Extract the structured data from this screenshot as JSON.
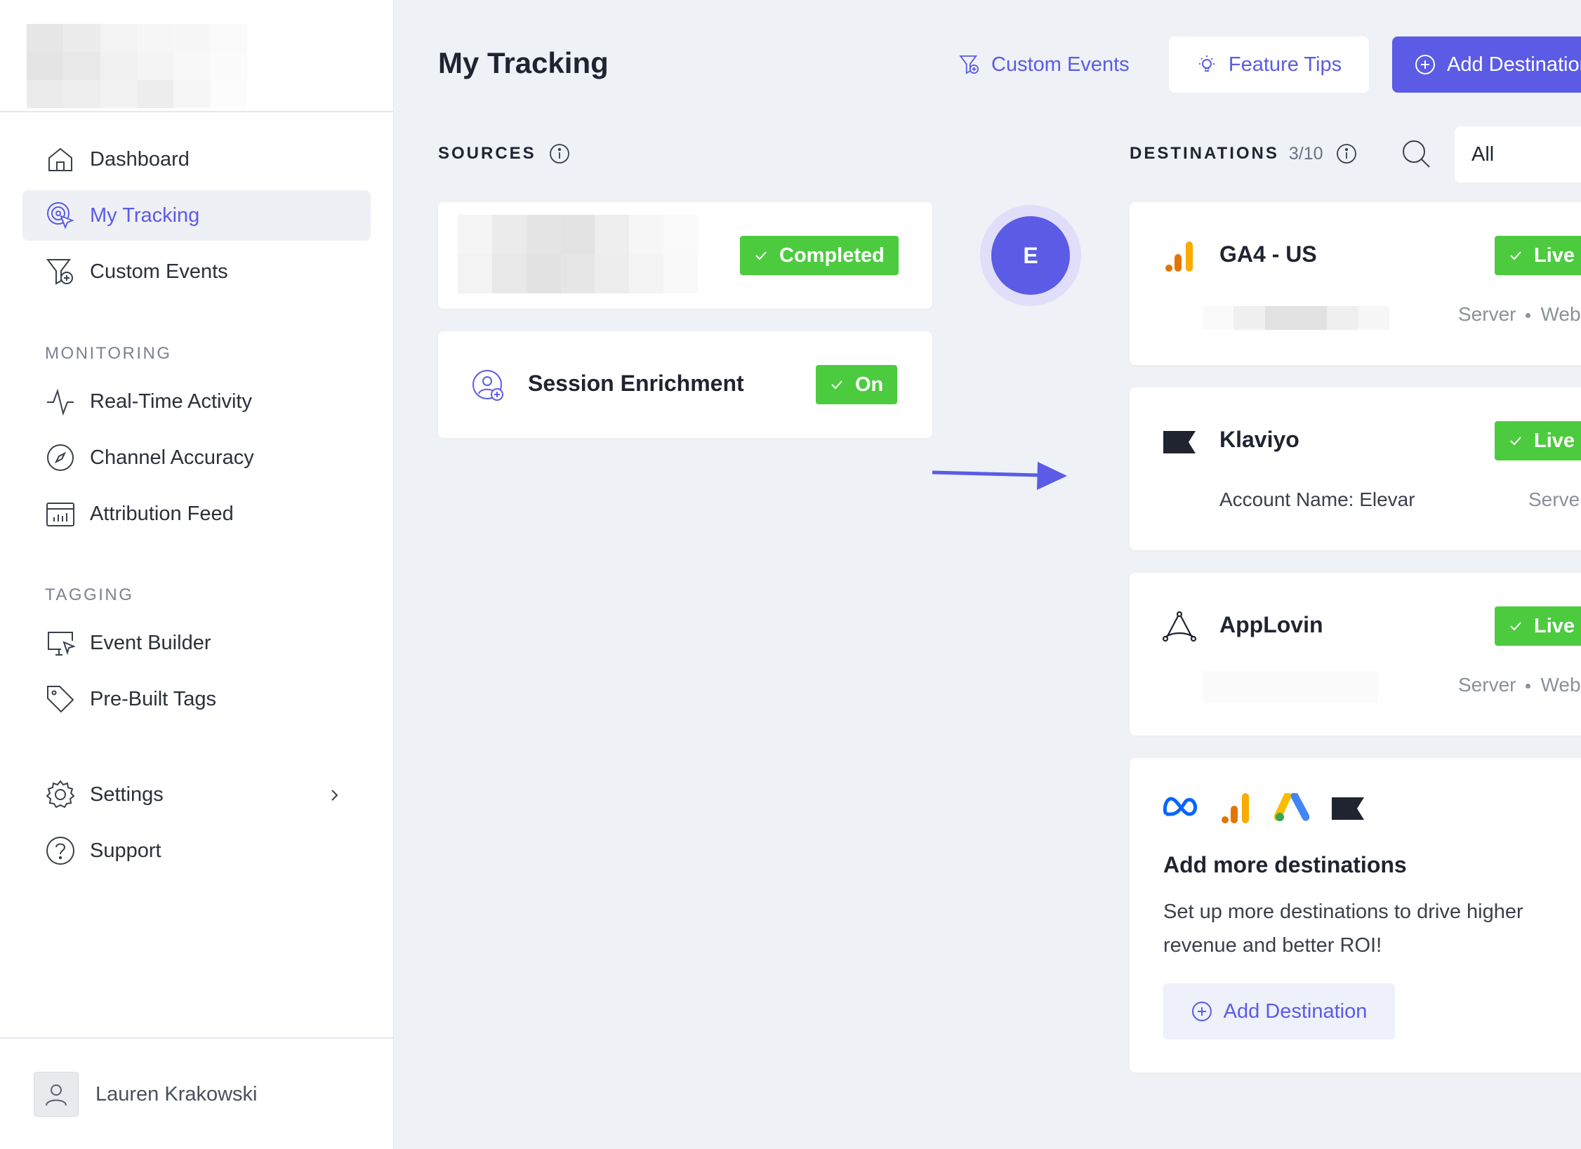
{
  "sidebar": {
    "nav": [
      {
        "label": "Dashboard",
        "icon": "home-icon"
      },
      {
        "label": "My Tracking",
        "icon": "tracking-target-icon",
        "active": true
      },
      {
        "label": "Custom Events",
        "icon": "funnel-plus-icon"
      }
    ],
    "monitoring_label": "MONITORING",
    "monitoring": [
      {
        "label": "Real-Time Activity",
        "icon": "pulse-icon"
      },
      {
        "label": "Channel Accuracy",
        "icon": "compass-icon"
      },
      {
        "label": "Attribution Feed",
        "icon": "calendar-chart-icon"
      }
    ],
    "tagging_label": "TAGGING",
    "tagging": [
      {
        "label": "Event Builder",
        "icon": "monitor-cursor-icon"
      },
      {
        "label": "Pre-Built Tags",
        "icon": "tag-icon"
      }
    ],
    "bottom": [
      {
        "label": "Settings",
        "icon": "gear-icon"
      },
      {
        "label": "Support",
        "icon": "question-circle-icon"
      }
    ],
    "user_name": "Lauren Krakowski"
  },
  "header": {
    "title": "My Tracking",
    "custom_events_link": "Custom Events",
    "feature_tips_button": "Feature Tips",
    "add_destination_button": "Add Destination"
  },
  "sources": {
    "label": "SOURCES",
    "cards": [
      {
        "status": "Completed"
      },
      {
        "title": "Session Enrichment",
        "status": "On"
      }
    ]
  },
  "connector": {
    "initial": "E"
  },
  "destinations": {
    "label": "DESTINATIONS",
    "count": "3/10",
    "filter_value": "All",
    "cards": [
      {
        "name": "GA4 - US",
        "status": "Live",
        "meta_type": "Server",
        "meta_channel": "Web"
      },
      {
        "name": "Klaviyo",
        "status": "Live",
        "account": "Account Name: Elevar",
        "meta_type": "Server"
      },
      {
        "name": "AppLovin",
        "status": "Live",
        "meta_type": "Server",
        "meta_channel": "Web"
      }
    ],
    "add_more": {
      "title": "Add more destinations",
      "text": "Set up more destinations to drive higher revenue and better ROI!",
      "button": "Add Destination",
      "icons": [
        "meta-icon",
        "google-analytics-icon",
        "google-ads-icon",
        "klaviyo-icon"
      ]
    }
  },
  "colors": {
    "accent": "#5b5be6",
    "success": "#4ccb3f",
    "background": "#eef1f5"
  }
}
